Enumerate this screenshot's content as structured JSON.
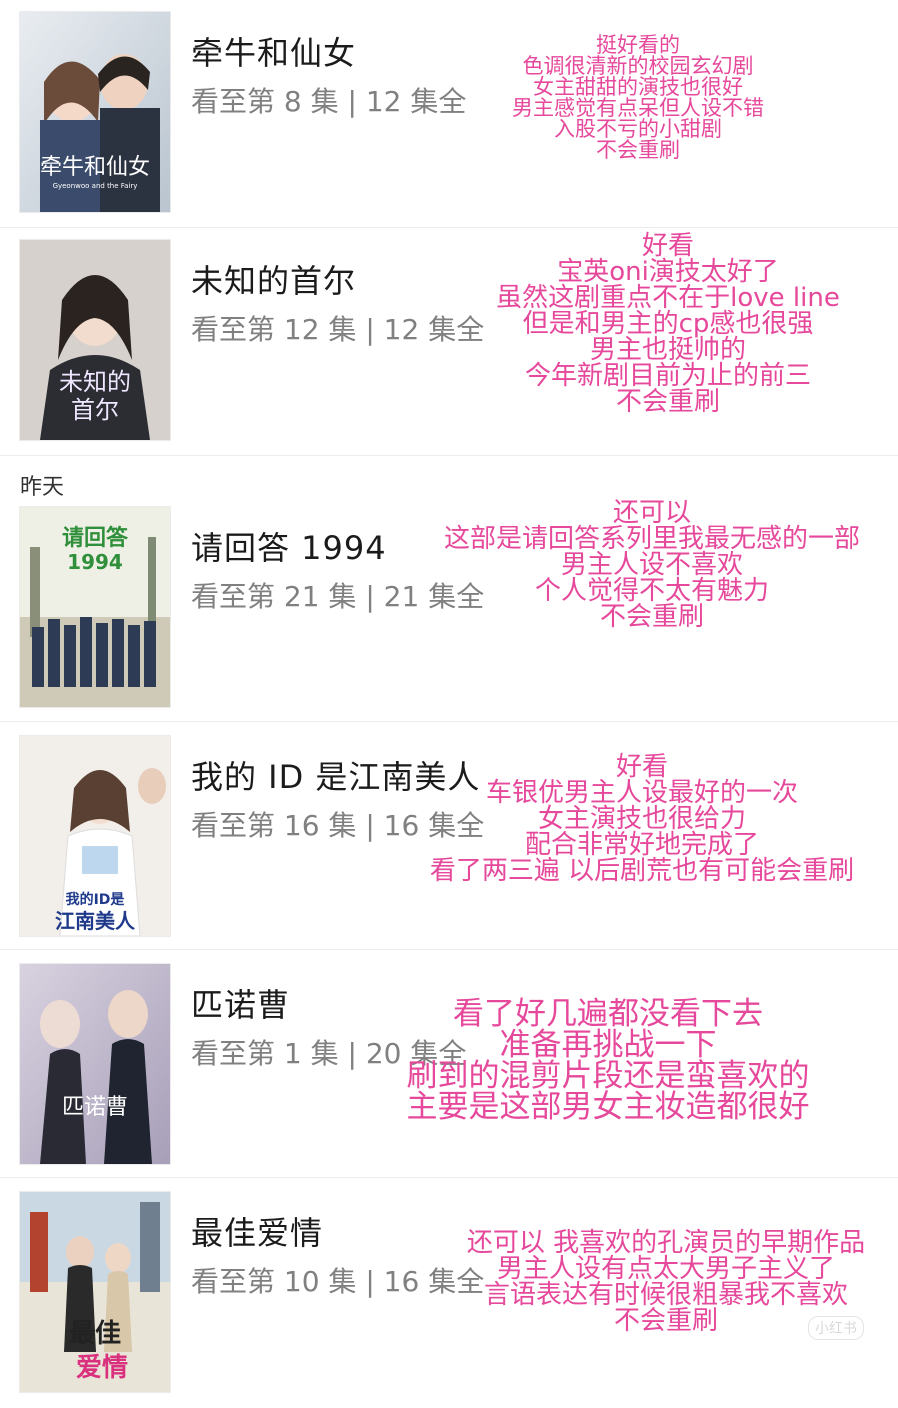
{
  "section_label": "昨天",
  "watermark": "小红书",
  "items": [
    {
      "title": "牵牛和仙女",
      "progress": "看至第 8 集 | 12 集全",
      "poster_title": "牵牛和仙女",
      "poster_subtitle": "Gyeonwoo and the Fairy",
      "note": [
        "挺好看的",
        "色调很清新的校园玄幻剧",
        "女主甜甜的演技也很好",
        "男主感觉有点呆但人设不错",
        "入股不亏的小甜剧",
        "不会重刷"
      ]
    },
    {
      "title": "未知的首尔",
      "progress": "看至第 12 集 | 12 集全",
      "poster_title_line1": "未知的",
      "poster_title_line2": "首尔",
      "note": [
        "好看",
        "宝英oni演技太好了",
        "虽然这剧重点不在于love line",
        "但是和男主的cp感也很强",
        "男主也挺帅的",
        "今年新剧目前为止的前三",
        "不会重刷"
      ]
    },
    {
      "title": "请回答 1994",
      "progress": "看至第 21 集 | 21 集全",
      "poster_title": "请回答",
      "poster_subtitle": "1994",
      "note": [
        "还可以",
        "这部是请回答系列里我最无感的一部",
        "男主人设不喜欢",
        "个人觉得不太有魅力",
        "不会重刷"
      ]
    },
    {
      "title": "我的 ID 是江南美人",
      "progress": "看至第 16 集 | 16 集全",
      "poster_title_line1": "我的ID是",
      "poster_title_line2": "江南美人",
      "note": [
        "好看",
        "车银优男主人设最好的一次",
        "女主演技也很给力",
        "配合非常好地完成了",
        "看了两三遍 以后剧荒也有可能会重刷"
      ]
    },
    {
      "title": "匹诺曹",
      "progress": "看至第 1 集 | 20 集全",
      "poster_title": "匹诺曹",
      "note": [
        "看了好几遍都没看下去",
        "准备再挑战一下",
        "刷到的混剪片段还是蛮喜欢的",
        "主要是这部男女主妆造都很好"
      ]
    },
    {
      "title": "最佳爱情",
      "progress": "看至第 10 集 | 16 集全",
      "poster_title_line1": "最佳",
      "poster_title_line2": "爱情",
      "note": [
        "还可以 我喜欢的孔演员的早期作品",
        "男主人设有点太大男子主义了",
        "言语表达有时候很粗暴我不喜欢",
        "不会重刷"
      ]
    }
  ]
}
